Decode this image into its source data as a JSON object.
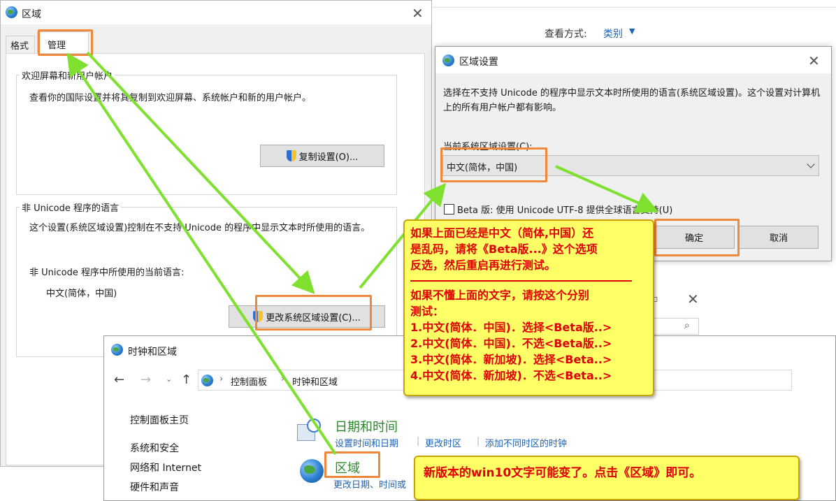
{
  "region_window": {
    "title": "区域",
    "tabs": [
      "格式",
      "管理"
    ],
    "welcome_group": {
      "label": "欢迎屏幕和新用户帐户",
      "desc": "查看你的国际设置并将其复制到欢迎屏幕、系统帐户和新的用户帐户。",
      "copy_button": "复制设置(O)..."
    },
    "unicode_group": {
      "label": "非 Unicode 程序的语言",
      "desc": "这个设置(系统区域设置)控制在不支持 Unicode 的程序中显示文本时所使用的语言。",
      "current_label": "非 Unicode 程序中所使用的当前语言:",
      "current_value": "中文(简体，中国)",
      "change_button": "更改系统区域设置(C)..."
    }
  },
  "background_control_panel": {
    "view_by_label": "查看方式:",
    "view_by_value": "类别"
  },
  "region_settings_dialog": {
    "title": "区域设置",
    "desc": "选择在不支持 Unicode 的程序中显示文本时所使用的语言(系统区域设置)。这个设置对计算机上的所有用户帐户都有影响。",
    "current_label": "当前系统区域设置(C):",
    "current_value": "中文(简体，中国)",
    "beta_checkbox": "Beta 版: 使用 Unicode UTF-8 提供全球语言支持(U)",
    "ok_button": "确定",
    "cancel_button": "取消"
  },
  "clock_region_window": {
    "title": "时钟和区域",
    "breadcrumb": [
      "控制面板",
      "时钟和区域"
    ],
    "sidebar": [
      "控制面板主页",
      "系统和安全",
      "网络和 Internet",
      "硬件和声音"
    ],
    "date_time": {
      "heading": "日期和时间",
      "links": [
        "设置时间和日期",
        "更改时区",
        "添加不同时区的时钟"
      ]
    },
    "region": {
      "heading": "区域",
      "link": "更改日期、时间或"
    }
  },
  "callout_main": {
    "line1": "如果上面已经是中文（简体,中国）还",
    "line2": "是乱码，请将《Beta版...》这个选项",
    "line3": "反选，然后重启再进行测试。",
    "line4": "如果不懂上面的文字，请按这个分别",
    "line5": "测试：",
    "items": [
      "1.中文(简体．中国)．选择<Beta版..>",
      "2.中文(简体．中国)．不选<Beta版..>",
      "3.中文(简体．新加坡)．选择<Beta..>",
      "4.中文(简体．新加坡)．不选<Beta..>"
    ]
  },
  "callout_bottom": {
    "text": "新版本的win10文字可能变了。点击《区域》即可。"
  },
  "colors": {
    "highlight_box": "#f0883c",
    "arrow": "#7fe030",
    "callout_bg": "#ffff66",
    "callout_text": "#e00000",
    "link": "#1e63b6",
    "heading_green": "#2a8a2a"
  }
}
